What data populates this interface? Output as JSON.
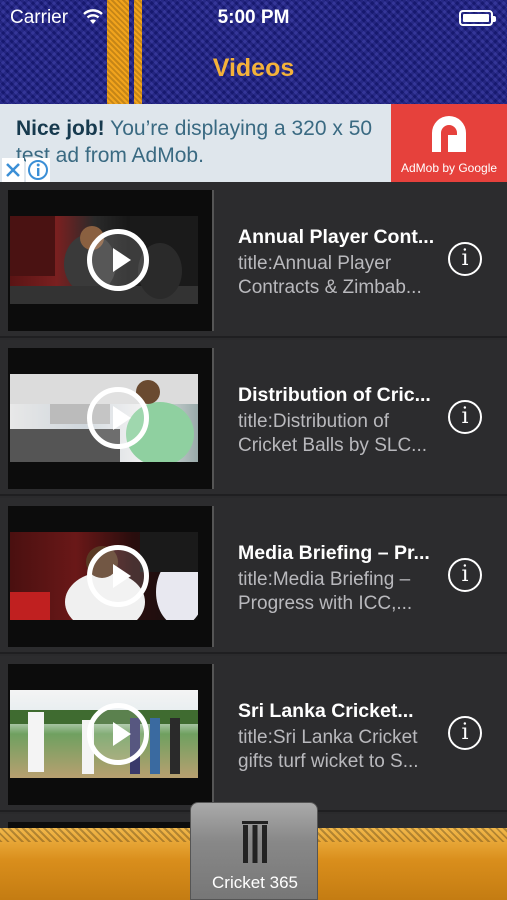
{
  "status_bar": {
    "carrier": "Carrier",
    "time": "5:00 PM"
  },
  "nav": {
    "title": "Videos"
  },
  "ad": {
    "headline": "Nice job!",
    "text": "You’re displaying a 320 x 50 test ad from AdMob.",
    "logo_caption": "AdMob by Google"
  },
  "videos": [
    {
      "title": "Annual Player Cont...",
      "desc_line1": "title:Annual Player",
      "desc_line2": "Contracts & Zimbab..."
    },
    {
      "title": "Distribution of Cric...",
      "desc_line1": "title:Distribution of",
      "desc_line2": "Cricket Balls by SLC..."
    },
    {
      "title": "Media Briefing – Pr...",
      "desc_line1": "title:Media Briefing –",
      "desc_line2": "Progress with ICC,..."
    },
    {
      "title": "Sri Lanka Cricket...",
      "desc_line1": "title:Sri Lanka Cricket",
      "desc_line2": "gifts turf wicket to S..."
    }
  ],
  "tab_bar": {
    "center_label": "Cricket 365"
  },
  "colors": {
    "header_blue": "#1d1f8c",
    "accent_orange": "#f1a31c",
    "title_gold": "#f4b23a",
    "ad_red": "#e6413c",
    "row_bg": "#2c2c2e"
  },
  "icons": [
    "wifi-icon",
    "battery-icon",
    "admob-logo-icon",
    "close-icon",
    "info-icon",
    "play-icon",
    "stumps-icon"
  ]
}
